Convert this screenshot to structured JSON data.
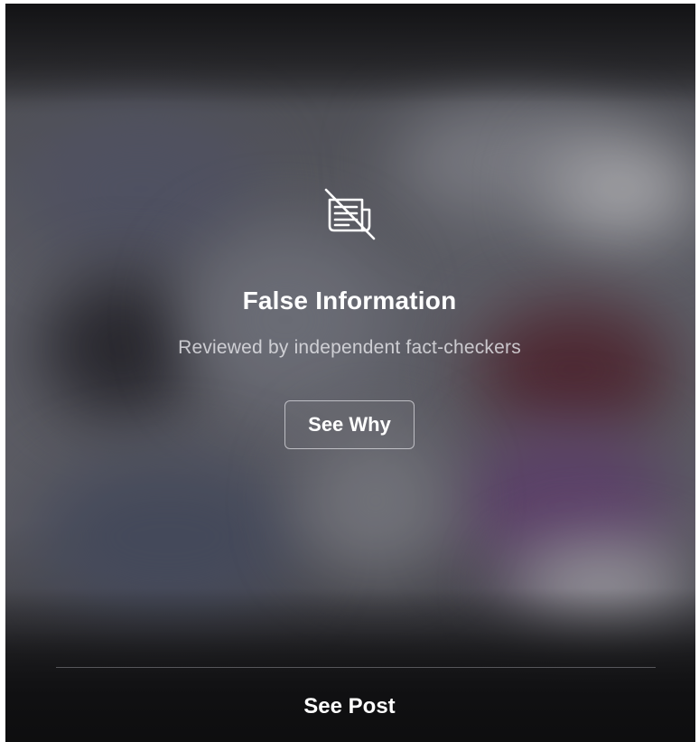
{
  "overlay": {
    "icon": "false-information-icon",
    "title": "False Information",
    "subtitle": "Reviewed by independent fact-checkers",
    "see_why_label": "See Why"
  },
  "footer": {
    "see_post_label": "See Post"
  },
  "colors": {
    "text_primary": "#ffffff",
    "text_secondary": "#c8c8cf",
    "button_border": "#d8d8de"
  }
}
